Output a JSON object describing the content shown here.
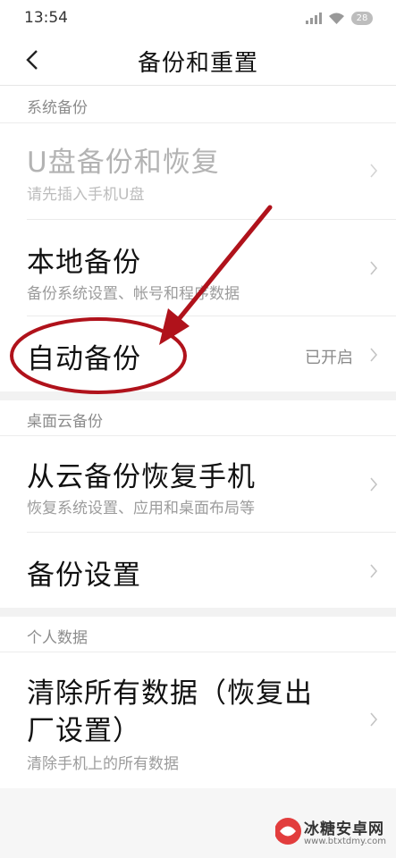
{
  "status_bar": {
    "time": "13:54",
    "battery": "28"
  },
  "header": {
    "title": "备份和重置"
  },
  "sections": {
    "system_backup": {
      "label": "系统备份",
      "usb": {
        "title": "U盘备份和恢复",
        "subtitle": "请先插入手机U盘"
      },
      "local": {
        "title": "本地备份",
        "subtitle": "备份系统设置、帐号和程序数据"
      },
      "auto": {
        "title": "自动备份",
        "value": "已开启"
      }
    },
    "cloud_backup": {
      "label": "桌面云备份",
      "restore": {
        "title": "从云备份恢复手机",
        "subtitle": "恢复系统设置、应用和桌面布局等"
      },
      "settings": {
        "title": "备份设置"
      }
    },
    "personal_data": {
      "label": "个人数据",
      "wipe": {
        "title_line1": "清除所有数据（恢复出",
        "title_line2": "厂设置）",
        "subtitle": "清除手机上的所有数据"
      }
    }
  },
  "watermark": {
    "name": "冰糖安卓网",
    "url": "www.btxtdmy.com"
  },
  "colors": {
    "annotation": "#b0121b",
    "text_primary": "#111111",
    "text_secondary": "#9c9c9c",
    "disabled": "#b3b3b3"
  },
  "icons": [
    "signal-icon",
    "wifi-icon",
    "battery-icon",
    "back-arrow-icon",
    "chevron-right-icon",
    "annotation-arrow",
    "annotation-circle",
    "watermark-logo"
  ]
}
